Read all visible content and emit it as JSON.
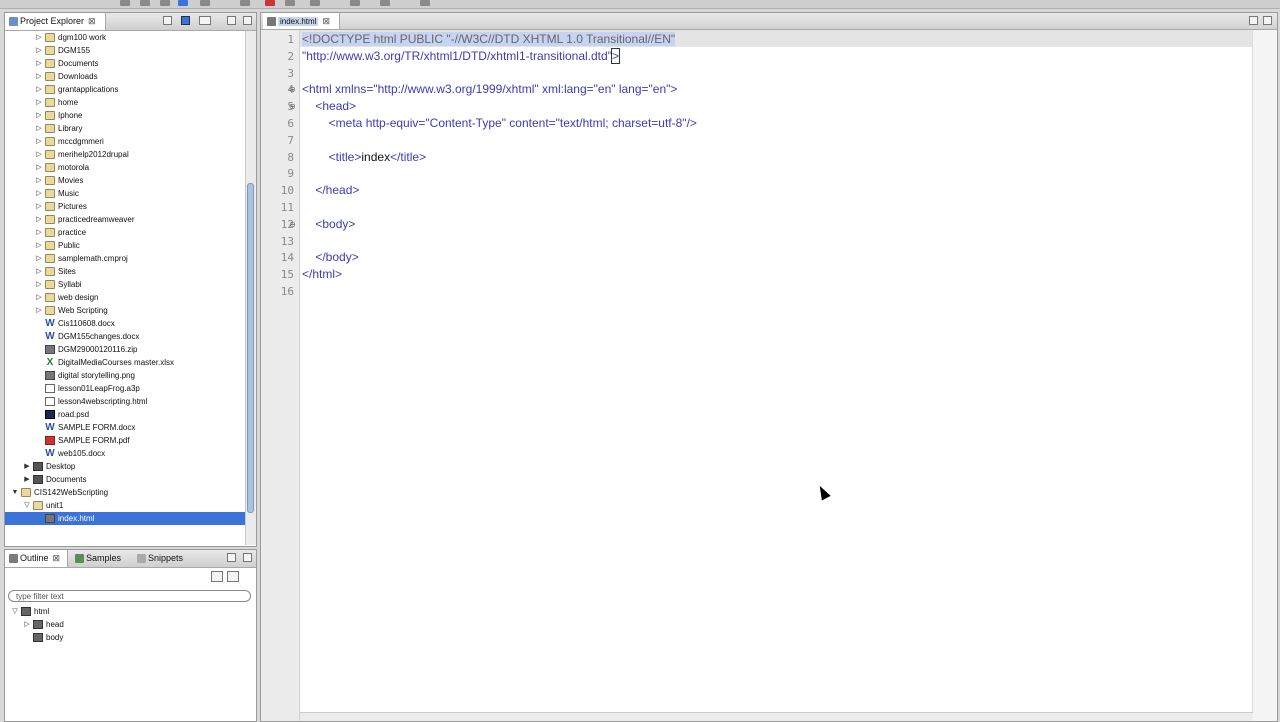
{
  "explorer": {
    "tab_label": "Project Explorer",
    "close_glyph": "⊠",
    "items": [
      {
        "label": "dgm100 work",
        "type": "folder",
        "level": 2,
        "twisty": "▷"
      },
      {
        "label": "DGM155",
        "type": "folder",
        "level": 2,
        "twisty": "▷"
      },
      {
        "label": "Documents",
        "type": "folder",
        "level": 2,
        "twisty": "▷"
      },
      {
        "label": "Downloads",
        "type": "folder",
        "level": 2,
        "twisty": "▷"
      },
      {
        "label": "grantapplications",
        "type": "folder",
        "level": 2,
        "twisty": "▷"
      },
      {
        "label": "home",
        "type": "folder",
        "level": 2,
        "twisty": "▷"
      },
      {
        "label": "Iphone",
        "type": "folder",
        "level": 2,
        "twisty": "▷"
      },
      {
        "label": "Library",
        "type": "folder",
        "level": 2,
        "twisty": "▷"
      },
      {
        "label": "mccdgmmeri",
        "type": "folder",
        "level": 2,
        "twisty": "▷"
      },
      {
        "label": "merihelp2012drupal",
        "type": "folder",
        "level": 2,
        "twisty": "▷"
      },
      {
        "label": "motorola",
        "type": "folder",
        "level": 2,
        "twisty": "▷"
      },
      {
        "label": "Movies",
        "type": "folder",
        "level": 2,
        "twisty": "▷"
      },
      {
        "label": "Music",
        "type": "folder",
        "level": 2,
        "twisty": "▷"
      },
      {
        "label": "Pictures",
        "type": "folder",
        "level": 2,
        "twisty": "▷"
      },
      {
        "label": "practicedreamweaver",
        "type": "folder",
        "level": 2,
        "twisty": "▷"
      },
      {
        "label": "practice",
        "type": "folder",
        "level": 2,
        "twisty": "▷"
      },
      {
        "label": "Public",
        "type": "folder",
        "level": 2,
        "twisty": "▷"
      },
      {
        "label": "samplemath.cmproj",
        "type": "folder",
        "level": 2,
        "twisty": "▷"
      },
      {
        "label": "Sites",
        "type": "folder",
        "level": 2,
        "twisty": "▷"
      },
      {
        "label": "Syllabi",
        "type": "folder",
        "level": 2,
        "twisty": "▷"
      },
      {
        "label": "web design",
        "type": "folder",
        "level": 2,
        "twisty": "▷"
      },
      {
        "label": "Web Scripting",
        "type": "folder",
        "level": 2,
        "twisty": "▷"
      },
      {
        "label": "Cis110608.docx",
        "type": "word",
        "level": 2,
        "twisty": ""
      },
      {
        "label": "DGM155changes.docx",
        "type": "word",
        "level": 2,
        "twisty": ""
      },
      {
        "label": "DGM29000120116.zip",
        "type": "generic",
        "level": 2,
        "twisty": ""
      },
      {
        "label": "DigitalMediaCourses master.xlsx",
        "type": "excel",
        "level": 2,
        "twisty": ""
      },
      {
        "label": "digital storytelling.png",
        "type": "image",
        "level": 2,
        "twisty": ""
      },
      {
        "label": "lesson01LeapFrog.a3p",
        "type": "file",
        "level": 2,
        "twisty": ""
      },
      {
        "label": "lesson4webscripting.html",
        "type": "file",
        "level": 2,
        "twisty": ""
      },
      {
        "label": "road.psd",
        "type": "psd",
        "level": 2,
        "twisty": ""
      },
      {
        "label": "SAMPLE FORM.docx",
        "type": "word",
        "level": 2,
        "twisty": ""
      },
      {
        "label": "SAMPLE FORM.pdf",
        "type": "pdf",
        "level": 2,
        "twisty": ""
      },
      {
        "label": "web105.docx",
        "type": "word",
        "level": 2,
        "twisty": ""
      },
      {
        "label": "Desktop",
        "type": "drive",
        "level": 1,
        "twisty": "▶"
      },
      {
        "label": "Documents",
        "type": "drive",
        "level": 1,
        "twisty": "▶"
      },
      {
        "label": "CIS142WebScripting",
        "type": "project",
        "level": 0,
        "twisty": "▼"
      },
      {
        "label": "unit1",
        "type": "folder",
        "level": 1,
        "twisty": "▽"
      },
      {
        "label": "index.html",
        "type": "html",
        "level": 2,
        "twisty": "",
        "selected": true
      }
    ]
  },
  "outline": {
    "tabs": [
      "Outline",
      "Samples",
      "Snippets"
    ],
    "filter_placeholder": "type filter text",
    "nodes": [
      {
        "label": "html",
        "level": 0,
        "twisty": "▽"
      },
      {
        "label": "head",
        "level": 1,
        "twisty": "▷"
      },
      {
        "label": "body",
        "level": 1,
        "twisty": ""
      }
    ]
  },
  "editor": {
    "tab_label": "index.html",
    "lines": [
      {
        "n": "1",
        "fold": "",
        "parts": [
          {
            "t": "<!DOCTYPE html PUBLIC \"-//W3C//DTD XHTML 1.0 Transitional//EN\"",
            "c": "doct hl"
          }
        ]
      },
      {
        "n": "2",
        "fold": "",
        "parts": [
          {
            "t": "\"http://www.w3.org/TR/xhtml1/DTD/xhtml1-transitional.dtd\"",
            "c": "tag"
          },
          {
            "t": ">",
            "c": "tag curbox"
          }
        ]
      },
      {
        "n": "3",
        "fold": "",
        "parts": []
      },
      {
        "n": "4",
        "fold": "⊖",
        "parts": [
          {
            "t": "<html xmlns=\"http://www.w3.org/1999/xhtml\" xml:lang=\"en\" lang=\"en\">",
            "c": "tag"
          }
        ]
      },
      {
        "n": "5",
        "fold": "⊖",
        "parts": [
          {
            "t": "    <head>",
            "c": "tag"
          }
        ]
      },
      {
        "n": "6",
        "fold": "",
        "parts": [
          {
            "t": "        <meta http-equiv=\"Content-Type\" content=\"text/html; charset=utf-8\"/>",
            "c": "tag"
          }
        ]
      },
      {
        "n": "7",
        "fold": "",
        "parts": []
      },
      {
        "n": "8",
        "fold": "",
        "parts": [
          {
            "t": "        <title>",
            "c": "tag"
          },
          {
            "t": "index",
            "c": "txt"
          },
          {
            "t": "</title>",
            "c": "tag"
          }
        ]
      },
      {
        "n": "9",
        "fold": "",
        "parts": []
      },
      {
        "n": "10",
        "fold": "",
        "parts": [
          {
            "t": "    </head>",
            "c": "tag"
          }
        ]
      },
      {
        "n": "11",
        "fold": "",
        "parts": []
      },
      {
        "n": "12",
        "fold": "⊖",
        "parts": [
          {
            "t": "    <body>",
            "c": "tag"
          }
        ]
      },
      {
        "n": "13",
        "fold": "",
        "parts": []
      },
      {
        "n": "14",
        "fold": "",
        "parts": [
          {
            "t": "    </body>",
            "c": "tag"
          }
        ]
      },
      {
        "n": "15",
        "fold": "",
        "parts": [
          {
            "t": "</html>",
            "c": "tag"
          }
        ]
      },
      {
        "n": "16",
        "fold": "",
        "parts": []
      }
    ]
  }
}
